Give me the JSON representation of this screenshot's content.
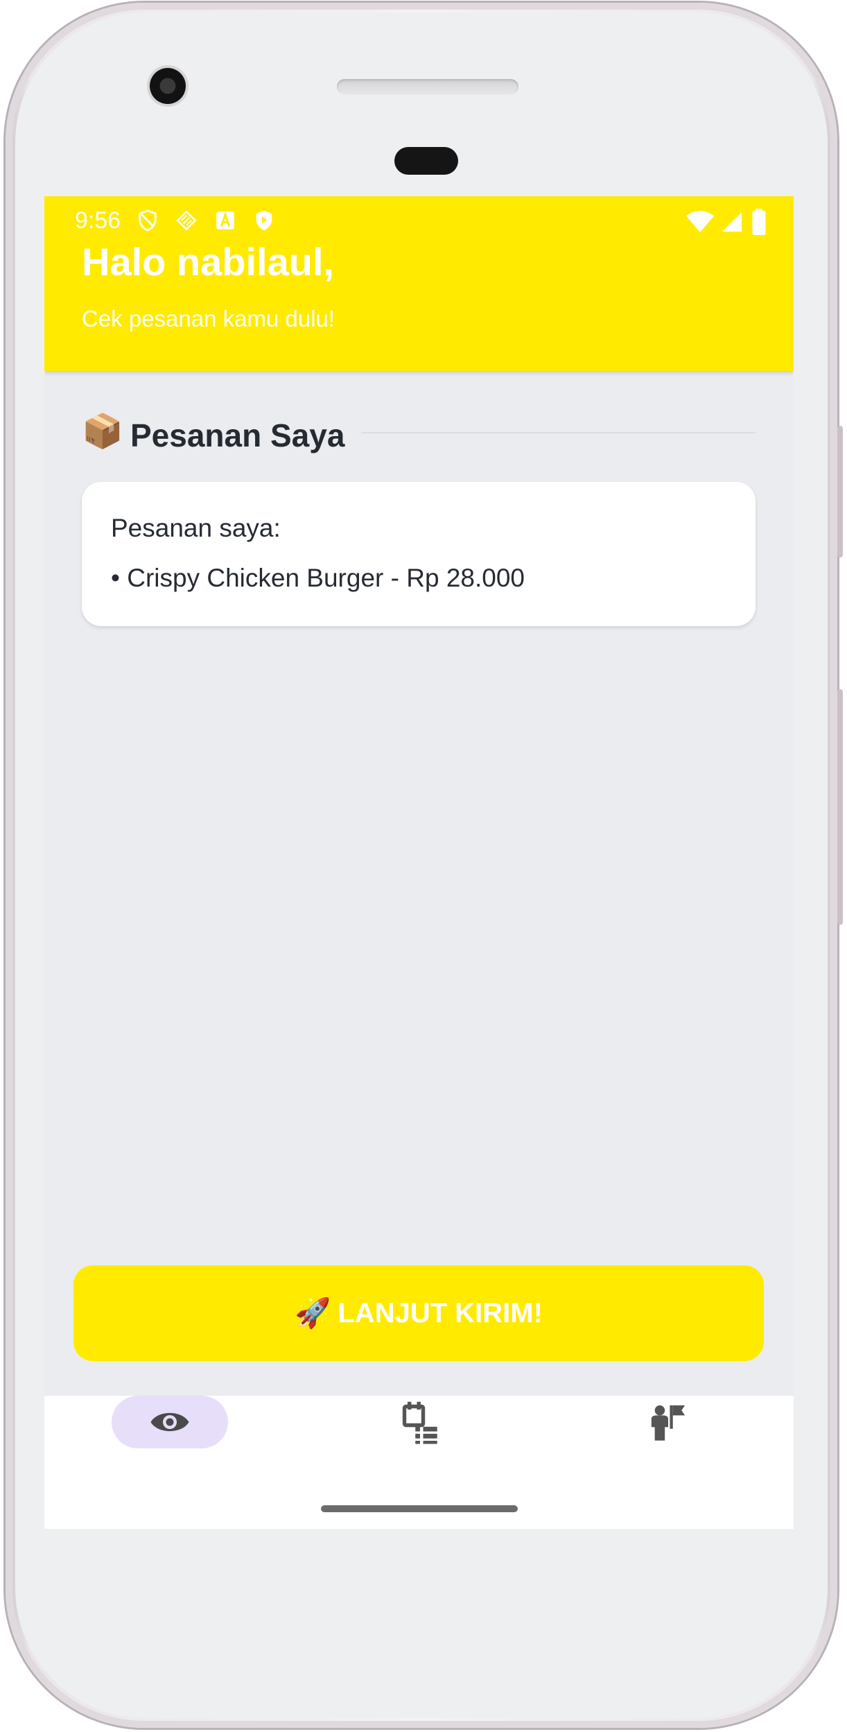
{
  "status_bar": {
    "time": "9:56",
    "left_icons": [
      "vpn-shield-icon",
      "cast-icon",
      "app-a-icon",
      "play-protect-icon"
    ],
    "right_icons": [
      "wifi-icon",
      "signal-icon",
      "battery-icon"
    ]
  },
  "header": {
    "greeting": "Halo nabilaul,",
    "subtitle": "Cek pesanan kamu dulu!",
    "background": "#FFEA00"
  },
  "section": {
    "emoji": "📦",
    "title": "Pesanan Saya"
  },
  "order_card": {
    "heading": "Pesanan saya:",
    "items": [
      "• Crispy Chicken Burger - Rp 28.000"
    ]
  },
  "cta": {
    "emoji": "🚀",
    "label": "LANJUT KIRIM!"
  },
  "bottom_nav": {
    "items": [
      {
        "icon": "eye-icon",
        "active": true
      },
      {
        "icon": "schedule-list-icon",
        "active": false
      },
      {
        "icon": "person-flag-icon",
        "active": false
      }
    ],
    "active_pill_color": "#E7DEFA"
  }
}
